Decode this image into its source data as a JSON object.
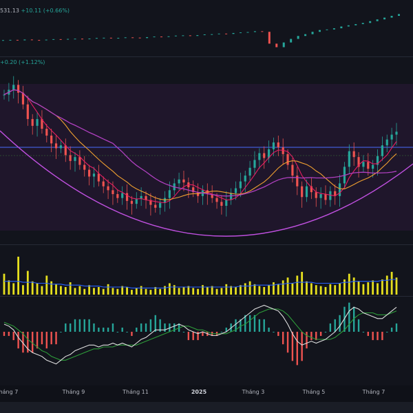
{
  "colors": {
    "up": "#26a69a",
    "down": "#ef5350",
    "ma_red": "#e91e63",
    "ma_orange": "#f0a030",
    "ma_purple": "#b040c0",
    "resistance": "#4a6cff",
    "volume_up": "#e6e01e",
    "volume_ma": "#2962ff",
    "macd": "#e0e0e0",
    "signal": "#2e9e3a",
    "hist_up": "#26a69a",
    "hist_down": "#ef5350"
  },
  "legend": {
    "index_value": "531.13",
    "index_change": "+10.11 (+0.66%)",
    "main_change": "+0.20 (+1.12%)"
  },
  "chart_data": [
    {
      "type": "line",
      "name": "index-overview",
      "x_labels": [],
      "values": [
        50.0,
        50.2,
        49.8,
        50.5,
        50.1,
        49.9,
        50.4,
        50.8,
        50.6,
        51.0,
        51.2,
        50.9,
        51.3,
        51.8,
        52.0,
        51.5,
        51.9,
        52.3,
        52.1,
        51.7,
        52.5,
        53.0,
        52.6,
        53.2,
        53.8,
        54.0,
        53.5,
        54.2,
        54.8,
        55.0,
        55.5,
        55.2,
        56.0,
        56.5,
        56.8,
        57.5,
        57.0,
        47.0,
        44.0,
        48.0,
        51.0,
        53.5,
        55.0,
        57.0,
        58.5,
        59.0,
        60.0,
        61.5,
        62.5,
        63.5,
        64.5,
        66.0,
        67.5,
        69.0,
        70.5,
        72.0
      ]
    },
    {
      "type": "candlestick",
      "name": "price",
      "x_ticks": [
        "Tháng 7",
        "Tháng 9",
        "Tháng 11",
        "2025",
        "Tháng 3",
        "Tháng 5",
        "Tháng 7"
      ],
      "close": [
        27.0,
        27.5,
        28.0,
        27.2,
        26.0,
        24.5,
        23.8,
        24.5,
        23.5,
        22.8,
        22.0,
        21.5,
        21.8,
        20.8,
        20.2,
        20.6,
        19.8,
        19.3,
        18.6,
        18.9,
        18.1,
        17.6,
        17.2,
        16.8,
        16.4,
        16.9,
        16.1,
        15.8,
        16.3,
        16.6,
        16.2,
        15.7,
        15.4,
        15.9,
        16.4,
        17.2,
        17.9,
        18.3,
        18.0,
        17.5,
        17.0,
        16.6,
        17.2,
        16.8,
        16.4,
        16.0,
        15.6,
        16.2,
        16.9,
        17.4,
        18.1,
        18.7,
        19.5,
        20.3,
        21.0,
        20.5,
        21.4,
        22.1,
        21.6,
        20.9,
        19.8,
        18.7,
        17.6,
        16.5,
        17.6,
        17.0,
        16.4,
        16.8,
        16.2,
        17.1,
        16.6,
        17.9,
        19.6,
        21.2,
        20.6,
        19.6,
        20.1,
        19.4,
        19.8,
        20.7,
        21.8,
        22.4,
        22.9,
        23.2
      ],
      "resistance": 21.6,
      "ylim": [
        12,
        30
      ],
      "moving_averages": [
        "short",
        "medium",
        "long"
      ]
    },
    {
      "type": "bar",
      "name": "volume",
      "values": [
        22,
        15,
        12,
        40,
        10,
        25,
        14,
        12,
        9,
        20,
        14,
        11,
        9,
        8,
        13,
        7,
        9,
        6,
        10,
        7,
        8,
        6,
        11,
        7,
        6,
        9,
        8,
        5,
        7,
        9,
        6,
        5,
        8,
        6,
        9,
        12,
        10,
        7,
        8,
        9,
        7,
        6,
        10,
        8,
        9,
        6,
        7,
        11,
        9,
        8,
        10,
        12,
        14,
        11,
        9,
        8,
        10,
        13,
        11,
        15,
        18,
        12,
        20,
        24,
        14,
        12,
        10,
        9,
        8,
        11,
        10,
        12,
        16,
        22,
        18,
        14,
        11,
        13,
        15,
        12,
        16,
        20,
        24,
        18
      ],
      "ma_values": [
        14,
        14,
        14,
        14,
        13,
        13,
        13,
        12,
        12,
        12,
        11,
        11,
        11,
        10,
        10,
        10,
        10,
        9,
        9,
        9,
        9,
        8,
        8,
        8,
        8,
        8,
        8,
        7,
        7,
        7,
        7,
        7,
        7,
        7,
        7,
        8,
        8,
        8,
        8,
        8,
        8,
        8,
        8,
        8,
        8,
        8,
        8,
        8,
        8,
        8,
        9,
        9,
        9,
        10,
        10,
        10,
        10,
        10,
        11,
        11,
        12,
        12,
        13,
        13,
        13,
        13,
        12,
        12,
        12,
        12,
        12,
        12,
        13,
        13,
        14,
        14,
        14,
        14,
        14,
        14,
        15,
        15,
        16,
        16
      ],
      "ylim": [
        0,
        45
      ]
    },
    {
      "type": "line",
      "name": "macd",
      "macd": [
        0.4,
        0.3,
        0.1,
        -0.3,
        -0.6,
        -0.9,
        -1.1,
        -1.2,
        -1.3,
        -1.5,
        -1.6,
        -1.7,
        -1.5,
        -1.3,
        -1.2,
        -1.0,
        -0.9,
        -0.8,
        -0.7,
        -0.7,
        -0.8,
        -0.7,
        -0.7,
        -0.6,
        -0.7,
        -0.6,
        -0.7,
        -0.8,
        -0.6,
        -0.4,
        -0.3,
        -0.1,
        0.1,
        0.1,
        0.1,
        0.2,
        0.3,
        0.4,
        0.3,
        0.1,
        0.0,
        -0.1,
        0.0,
        -0.1,
        -0.2,
        -0.2,
        -0.1,
        0.0,
        0.2,
        0.4,
        0.6,
        0.8,
        1.0,
        1.2,
        1.3,
        1.4,
        1.3,
        1.2,
        1.1,
        0.8,
        0.4,
        -0.1,
        -0.5,
        -0.7,
        -0.6,
        -0.5,
        -0.6,
        -0.5,
        -0.4,
        -0.2,
        0.0,
        0.3,
        0.7,
        1.1,
        1.3,
        1.2,
        1.0,
        0.9,
        0.8,
        0.7,
        0.7,
        0.9,
        1.1,
        1.3
      ],
      "signal": [
        0.5,
        0.4,
        0.3,
        0.1,
        -0.1,
        -0.4,
        -0.6,
        -0.8,
        -1.0,
        -1.1,
        -1.3,
        -1.4,
        -1.5,
        -1.5,
        -1.4,
        -1.3,
        -1.2,
        -1.1,
        -1.0,
        -0.9,
        -0.9,
        -0.8,
        -0.8,
        -0.8,
        -0.7,
        -0.7,
        -0.7,
        -0.7,
        -0.7,
        -0.6,
        -0.5,
        -0.4,
        -0.3,
        -0.2,
        -0.1,
        0.0,
        0.1,
        0.2,
        0.3,
        0.3,
        0.2,
        0.1,
        0.1,
        0.0,
        -0.1,
        -0.1,
        -0.1,
        -0.1,
        0.0,
        0.1,
        0.3,
        0.4,
        0.6,
        0.8,
        1.0,
        1.1,
        1.2,
        1.2,
        1.2,
        1.1,
        0.9,
        0.6,
        0.3,
        0.0,
        -0.2,
        -0.3,
        -0.4,
        -0.4,
        -0.4,
        -0.4,
        -0.3,
        -0.1,
        0.1,
        0.4,
        0.7,
        0.9,
        1.0,
        1.0,
        1.0,
        0.9,
        0.9,
        0.9,
        1.0,
        1.1
      ],
      "ylim": [
        -2,
        2
      ]
    }
  ]
}
